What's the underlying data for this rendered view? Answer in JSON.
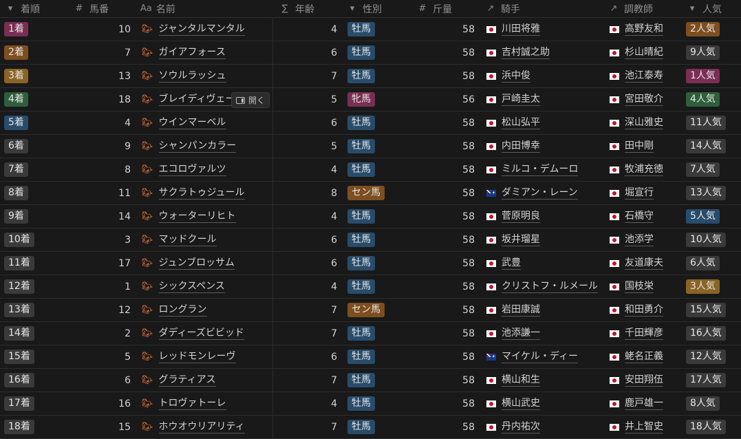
{
  "columns": [
    {
      "key": "rank",
      "icon": "▾",
      "label": "着順"
    },
    {
      "key": "num",
      "icon": "#",
      "label": "馬番"
    },
    {
      "key": "name",
      "icon": "Aa",
      "label": "名前"
    },
    {
      "key": "age",
      "icon": "∑",
      "label": "年齢"
    },
    {
      "key": "sex",
      "icon": "▾",
      "label": "性別"
    },
    {
      "key": "weight",
      "icon": "#",
      "label": "斤量"
    },
    {
      "key": "jockey",
      "icon": "↗",
      "label": "騎手"
    },
    {
      "key": "trainer",
      "icon": "↗",
      "label": "調教師"
    },
    {
      "key": "pop",
      "icon": "▾",
      "label": "人気"
    }
  ],
  "open_label": "開く",
  "colors": {
    "rank1": "#7a2e53",
    "rank2": "#7d4e1f",
    "rank3": "#8a6424",
    "rank4": "#2e5e3c",
    "rank5": "#284c6b",
    "rank_other": "#3a3a3a",
    "pop1": "#7a2e53",
    "pop2": "#7d4e1f",
    "pop3": "#8a6424",
    "pop4": "#2e5e3c",
    "pop5": "#284c6b",
    "pop_other": "#3a3a3a",
    "sex_牡馬": "#284c6b",
    "sex_牝馬": "#7a2e53",
    "sex_セン馬": "#7d4e1f",
    "horse_icon": "#d4713a"
  },
  "rows": [
    {
      "rank": "1着",
      "num": "10",
      "name": "ジャンタルマンタル",
      "age": "4",
      "sex": "牡馬",
      "weight": "58",
      "jockey": "川田将雅",
      "jflag": "jp",
      "trainer": "高野友和",
      "tflag": "jp",
      "pop": "2人気",
      "rank_n": 1,
      "pop_n": 2
    },
    {
      "rank": "2着",
      "num": "7",
      "name": "ガイアフォース",
      "age": "6",
      "sex": "牡馬",
      "weight": "58",
      "jockey": "吉村誠之助",
      "jflag": "jp",
      "trainer": "杉山晴紀",
      "tflag": "jp",
      "pop": "9人気",
      "rank_n": 2,
      "pop_n": 9
    },
    {
      "rank": "3着",
      "num": "13",
      "name": "ソウルラッシュ",
      "age": "7",
      "sex": "牡馬",
      "weight": "58",
      "jockey": "浜中俊",
      "jflag": "jp",
      "trainer": "池江泰寿",
      "tflag": "jp",
      "pop": "1人気",
      "rank_n": 3,
      "pop_n": 1
    },
    {
      "rank": "4着",
      "num": "18",
      "name": "ブレイディヴェーグ",
      "age": "5",
      "sex": "牝馬",
      "weight": "56",
      "jockey": "戸崎圭太",
      "jflag": "jp",
      "trainer": "宮田敬介",
      "tflag": "jp",
      "pop": "4人気",
      "rank_n": 4,
      "pop_n": 4,
      "hover": true
    },
    {
      "rank": "5着",
      "num": "4",
      "name": "ウインマーベル",
      "age": "6",
      "sex": "牡馬",
      "weight": "58",
      "jockey": "松山弘平",
      "jflag": "jp",
      "trainer": "深山雅史",
      "tflag": "jp",
      "pop": "11人気",
      "rank_n": 5,
      "pop_n": 11
    },
    {
      "rank": "6着",
      "num": "9",
      "name": "シャンパンカラー",
      "age": "5",
      "sex": "牡馬",
      "weight": "58",
      "jockey": "内田博幸",
      "jflag": "jp",
      "trainer": "田中剛",
      "tflag": "jp",
      "pop": "14人気",
      "rank_n": 6,
      "pop_n": 14
    },
    {
      "rank": "7着",
      "num": "8",
      "name": "エコロヴァルツ",
      "age": "4",
      "sex": "牡馬",
      "weight": "58",
      "jockey": "ミルコ・デムーロ",
      "jflag": "jp",
      "trainer": "牧浦充徳",
      "tflag": "jp",
      "pop": "7人気",
      "rank_n": 7,
      "pop_n": 7
    },
    {
      "rank": "8着",
      "num": "11",
      "name": "サクラトゥジュール",
      "age": "8",
      "sex": "セン馬",
      "weight": "58",
      "jockey": "ダミアン・レーン",
      "jflag": "au",
      "trainer": "堀宣行",
      "tflag": "jp",
      "pop": "13人気",
      "rank_n": 8,
      "pop_n": 13
    },
    {
      "rank": "9着",
      "num": "14",
      "name": "ウォーターリヒト",
      "age": "4",
      "sex": "牡馬",
      "weight": "58",
      "jockey": "菅原明良",
      "jflag": "jp",
      "trainer": "石橋守",
      "tflag": "jp",
      "pop": "5人気",
      "rank_n": 9,
      "pop_n": 5
    },
    {
      "rank": "10着",
      "num": "3",
      "name": "マッドクール",
      "age": "6",
      "sex": "牡馬",
      "weight": "58",
      "jockey": "坂井瑠星",
      "jflag": "jp",
      "trainer": "池添学",
      "tflag": "jp",
      "pop": "10人気",
      "rank_n": 10,
      "pop_n": 10
    },
    {
      "rank": "11着",
      "num": "17",
      "name": "ジュンブロッサム",
      "age": "6",
      "sex": "牡馬",
      "weight": "58",
      "jockey": "武豊",
      "jflag": "jp",
      "trainer": "友道康夫",
      "tflag": "jp",
      "pop": "6人気",
      "rank_n": 11,
      "pop_n": 6
    },
    {
      "rank": "12着",
      "num": "1",
      "name": "シックスペンス",
      "age": "4",
      "sex": "牡馬",
      "weight": "58",
      "jockey": "クリストフ・ルメール",
      "jflag": "jp",
      "trainer": "国枝栄",
      "tflag": "jp",
      "pop": "3人気",
      "rank_n": 12,
      "pop_n": 3
    },
    {
      "rank": "13着",
      "num": "12",
      "name": "ロングラン",
      "age": "7",
      "sex": "セン馬",
      "weight": "58",
      "jockey": "岩田康誠",
      "jflag": "jp",
      "trainer": "和田勇介",
      "tflag": "jp",
      "pop": "15人気",
      "rank_n": 13,
      "pop_n": 15
    },
    {
      "rank": "14着",
      "num": "2",
      "name": "ダディーズビビッド",
      "age": "7",
      "sex": "牡馬",
      "weight": "58",
      "jockey": "池添謙一",
      "jflag": "jp",
      "trainer": "千田輝彦",
      "tflag": "jp",
      "pop": "16人気",
      "rank_n": 14,
      "pop_n": 16
    },
    {
      "rank": "15着",
      "num": "5",
      "name": "レッドモンレーヴ",
      "age": "6",
      "sex": "牡馬",
      "weight": "58",
      "jockey": "マイケル・ディー",
      "jflag": "au",
      "trainer": "蛯名正義",
      "tflag": "jp",
      "pop": "12人気",
      "rank_n": 15,
      "pop_n": 12
    },
    {
      "rank": "16着",
      "num": "6",
      "name": "グラティアス",
      "age": "7",
      "sex": "牡馬",
      "weight": "58",
      "jockey": "横山和生",
      "jflag": "jp",
      "trainer": "安田翔伍",
      "tflag": "jp",
      "pop": "17人気",
      "rank_n": 16,
      "pop_n": 17
    },
    {
      "rank": "17着",
      "num": "16",
      "name": "トロヴァトーレ",
      "age": "4",
      "sex": "牡馬",
      "weight": "58",
      "jockey": "横山武史",
      "jflag": "jp",
      "trainer": "鹿戸雄一",
      "tflag": "jp",
      "pop": "8人気",
      "rank_n": 17,
      "pop_n": 8
    },
    {
      "rank": "18着",
      "num": "15",
      "name": "ホウオウリアリティ",
      "age": "7",
      "sex": "牡馬",
      "weight": "58",
      "jockey": "丹内祐次",
      "jflag": "jp",
      "trainer": "井上智史",
      "tflag": "jp",
      "pop": "18人気",
      "rank_n": 18,
      "pop_n": 18
    }
  ]
}
